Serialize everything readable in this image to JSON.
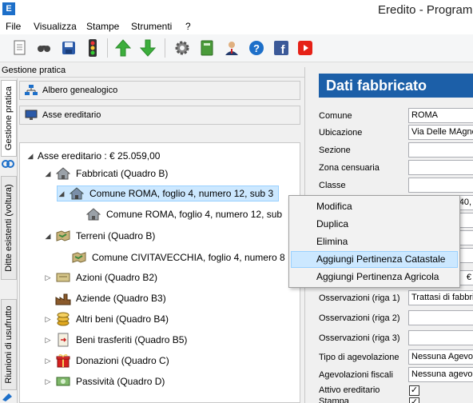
{
  "window": {
    "app_icon": "E",
    "title": "Eredito - Programm"
  },
  "menu": [
    "File",
    "Visualizza",
    "Stampe",
    "Strumenti",
    "?"
  ],
  "toolbar": {
    "icons": [
      "new-document-icon",
      "search-icon",
      "save-icon",
      "traffic-light-icon",
      "arrow-up-icon",
      "arrow-down-icon",
      "gear-icon",
      "book-icon",
      "user-icon",
      "help-icon",
      "facebook-icon",
      "youtube-icon"
    ],
    "colors": {
      "green": "#3cae3c",
      "blue": "#1d6fc9",
      "facebook": "#3b5998",
      "youtube": "#e62117"
    }
  },
  "section_header": "Gestione pratica",
  "vertical_tabs": [
    {
      "label": "Gestione pratica",
      "active": true
    },
    {
      "label": "Ditte esistenti (voltura)",
      "active": false
    },
    {
      "label": "Riunioni di usufrutto",
      "active": false
    }
  ],
  "panel_buttons": {
    "albero": "Albero genealogico",
    "asse": "Asse ereditario"
  },
  "tree": {
    "root": "Asse ereditario : € 25.059,00",
    "fabbricati": "Fabbricati (Quadro B)",
    "fabbricato_item": "Comune ROMA, foglio 4, numero 12, sub 3",
    "fabbricato_child": "Comune ROMA, foglio 4, numero 12, sub",
    "terreni": "Terreni (Quadro B)",
    "terreno_item": "Comune CIVITAVECCHIA, foglio 4, numero 8",
    "azioni": "Azioni (Quadro B2)",
    "aziende": "Aziende (Quadro B3)",
    "altri_beni": "Altri beni (Quadro B4)",
    "beni_trasferiti": "Beni trasferiti (Quadro B5)",
    "donazioni": "Donazioni (Quadro C)",
    "passivita": "Passività (Quadro D)"
  },
  "form": {
    "title": "Dati fabbricato",
    "comune_label": "Comune",
    "comune_value": "ROMA",
    "ubicazione_label": "Ubicazione",
    "ubicazione_value": "Via Delle MAgnol",
    "sezione_label": "Sezione",
    "zona_label": "Zona censuaria",
    "classe_label": "Classe",
    "peek_value_1": "40,",
    "peek_value_2": "€",
    "oss1_label": "Osservazioni (riga 1)",
    "oss1_value": "Trattasi di fabbri",
    "oss2_label": "Osservazioni (riga 2)",
    "oss3_label": "Osservazioni (riga 3)",
    "tipo_label": "Tipo di agevolazione",
    "tipo_value": "Nessuna Agevola",
    "agev_label": "Agevolazioni fiscali",
    "agev_value": "Nessuna agevola",
    "attivo_label": "Attivo ereditario",
    "stampa_label": "Stampa",
    "check_mark": "✓"
  },
  "context_menu": {
    "items": [
      "Modifica",
      "Duplica",
      "Elimina",
      "Aggiungi Pertinenza Catastale",
      "Aggiungi Pertinenza Agricola"
    ],
    "hover_index": 3
  }
}
